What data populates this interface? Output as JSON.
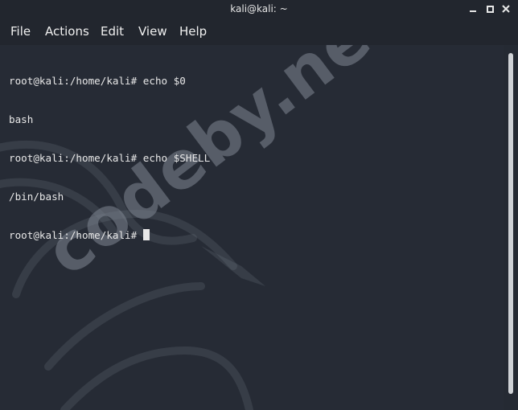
{
  "window": {
    "title": "kali@kali: ~"
  },
  "menu": {
    "items": [
      "File",
      "Actions",
      "Edit",
      "View",
      "Help"
    ]
  },
  "terminal": {
    "lines": [
      "root@kali:/home/kali# echo $0",
      "bash",
      "root@kali:/home/kali# echo $SHELL",
      "/bin/bash",
      "root@kali:/home/kali# "
    ]
  },
  "watermark": {
    "text": "codeby.net"
  },
  "colors": {
    "background": "#262b35",
    "titlebar": "#22262e",
    "text": "#e8e8e8"
  },
  "icons": {
    "minimize": "minimize-icon",
    "maximize": "maximize-icon",
    "close": "close-icon"
  }
}
